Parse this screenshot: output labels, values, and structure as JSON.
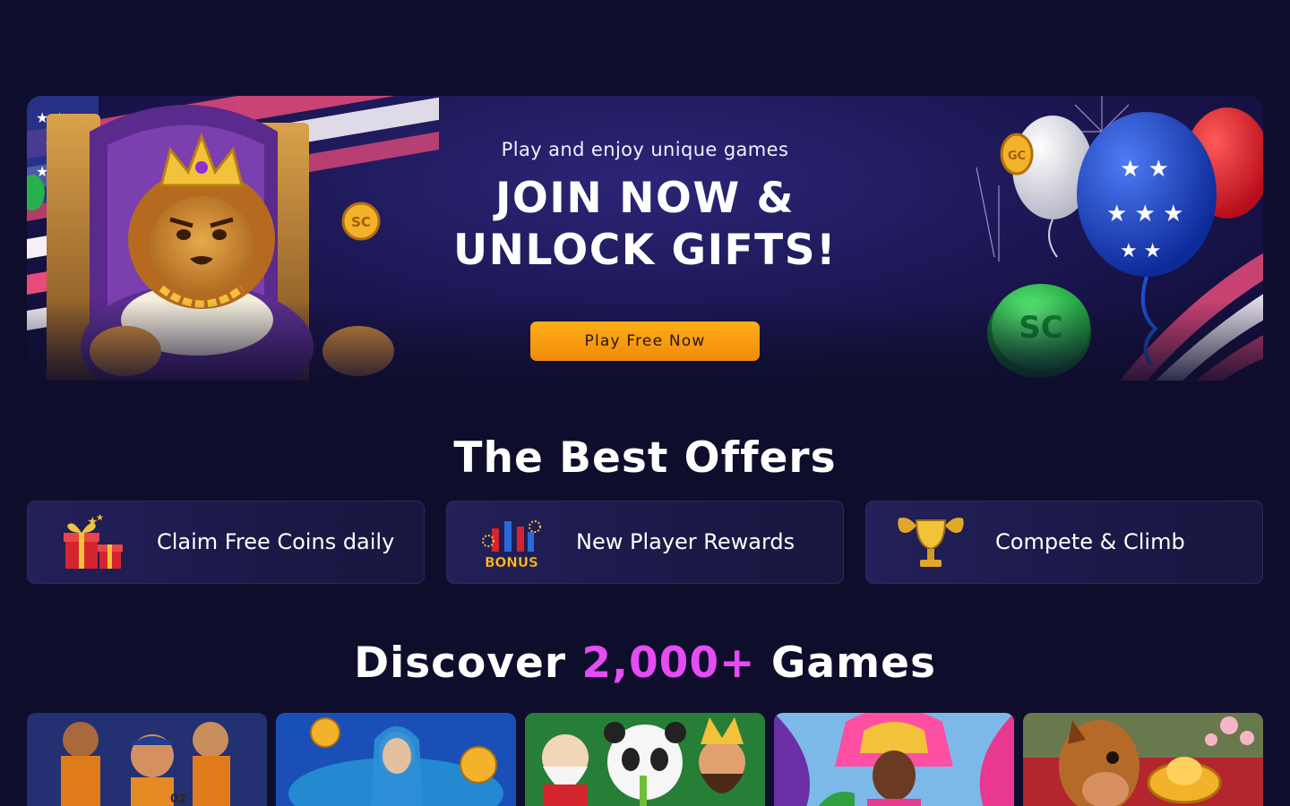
{
  "hero": {
    "subtitle": "Play and enjoy unique games",
    "title_line1": "JOIN NOW &",
    "title_line2": "UNLOCK GIFTS!",
    "cta_label": "Play Free Now",
    "coin_left_text": "SC",
    "coin_right_small_text": "GC",
    "coin_right_big_text": "SC"
  },
  "offers": {
    "title": "The Best Offers",
    "items": [
      {
        "label": "Claim Free Coins daily",
        "icon": "gift-boxes-icon"
      },
      {
        "label": "New Player Rewards",
        "icon": "bonus-fireworks-icon",
        "icon_text": "BONUS"
      },
      {
        "label": "Compete & Climb",
        "icon": "trophy-icon"
      }
    ]
  },
  "games": {
    "title_prefix": "Discover",
    "title_accent": "2,000+",
    "title_suffix": "Games",
    "tiles": [
      {
        "name": "prison-gang-game",
        "number_badge": "02"
      },
      {
        "name": "water-goddess-game"
      },
      {
        "name": "panda-fortune-game"
      },
      {
        "name": "carnival-queen-game"
      },
      {
        "name": "golden-horse-game"
      }
    ]
  },
  "colors": {
    "background": "#0f0d2c",
    "accent_purple": "#e54cf2",
    "cta_orange": "#f7990f",
    "card_bg": "#1d1b4b"
  }
}
